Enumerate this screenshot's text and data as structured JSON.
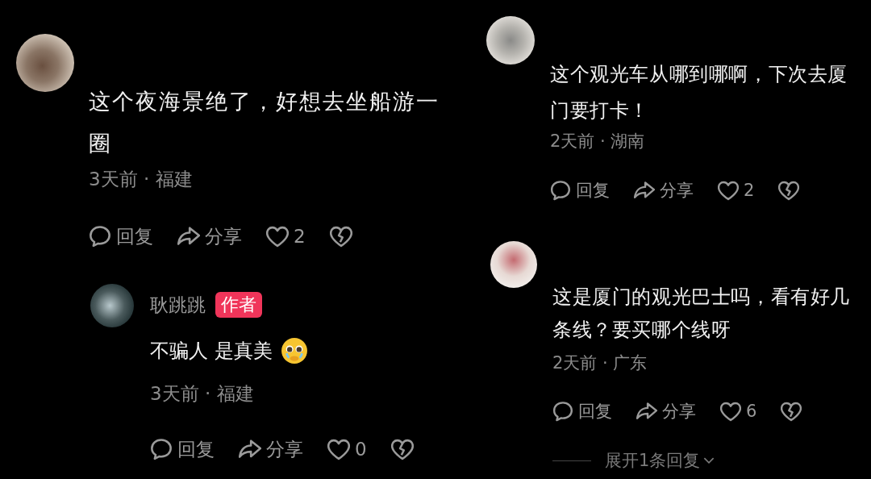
{
  "columns": [
    {
      "comments": [
        {
          "text": "这个夜海景绝了，好想去坐船游一圈",
          "meta": "3天前 · 福建",
          "actions": {
            "reply": "回复",
            "share": "分享",
            "likes": "2"
          },
          "replies": [
            {
              "author": "耿跳跳",
              "badge": "作者",
              "text": "不骗人 是真美",
              "trailing_emoji": true,
              "meta": "3天前 · 福建",
              "actions": {
                "reply": "回复",
                "share": "分享",
                "likes": "0"
              }
            }
          ]
        }
      ]
    },
    {
      "comments": [
        {
          "text": "这个观光车从哪到哪啊，下次去厦门要打卡！",
          "meta": "2天前 · 湖南",
          "actions": {
            "reply": "回复",
            "share": "分享",
            "likes": "2"
          }
        },
        {
          "text": "这是厦门的观光巴士吗，看有好几条线？要买哪个线呀",
          "meta": "2天前 · 广东",
          "actions": {
            "reply": "回复",
            "share": "分享",
            "likes": "6"
          },
          "expand": "展开1条回复"
        }
      ]
    }
  ]
}
